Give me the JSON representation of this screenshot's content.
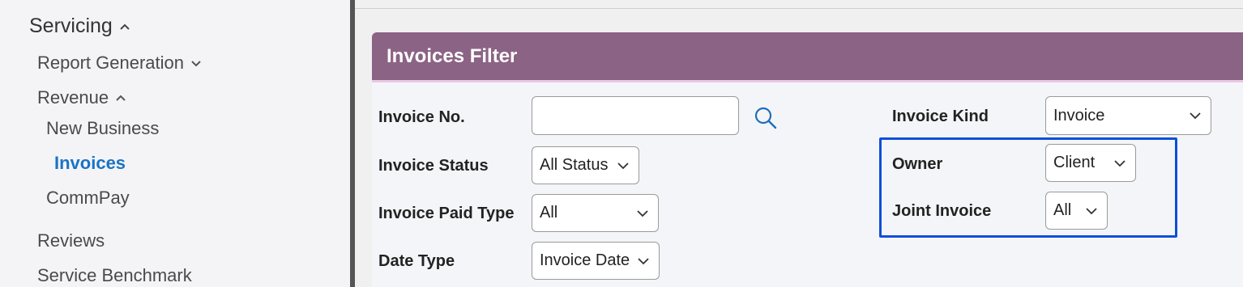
{
  "sidebar": {
    "servicing": "Servicing",
    "report_generation": "Report Generation",
    "revenue": "Revenue",
    "new_business": "New Business",
    "invoices": "Invoices",
    "commpay": "CommPay",
    "reviews": "Reviews",
    "service_benchmark": "Service Benchmark"
  },
  "panel": {
    "title": "Invoices Filter"
  },
  "filters": {
    "invoice_no": {
      "label": "Invoice No.",
      "value": ""
    },
    "invoice_status": {
      "label": "Invoice Status",
      "value": "All Status"
    },
    "invoice_paid_type": {
      "label": "Invoice Paid Type",
      "value": "All"
    },
    "date_type": {
      "label": "Date Type",
      "value": "Invoice Date"
    },
    "invoice_kind": {
      "label": "Invoice Kind",
      "value": "Invoice"
    },
    "owner": {
      "label": "Owner",
      "value": "Client"
    },
    "joint_invoice": {
      "label": "Joint Invoice",
      "value": "All"
    }
  },
  "colors": {
    "header": "#8b6384",
    "active_link": "#1a73c7",
    "highlight": "#0d50d8"
  }
}
